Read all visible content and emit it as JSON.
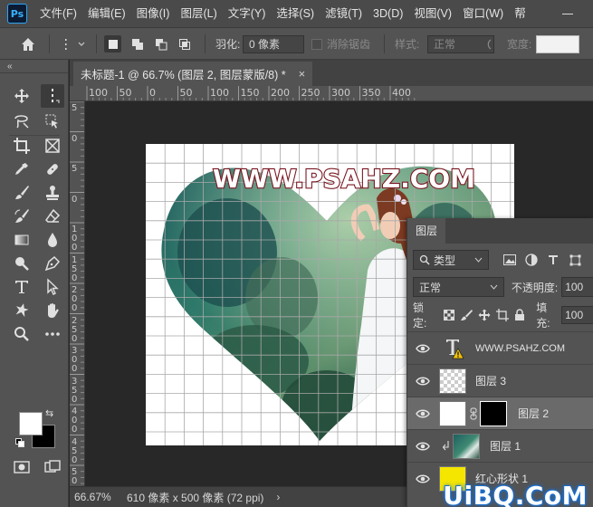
{
  "app": {
    "logo": "Ps"
  },
  "menu": [
    "文件(F)",
    "编辑(E)",
    "图像(I)",
    "图层(L)",
    "文字(Y)",
    "选择(S)",
    "滤镜(T)",
    "3D(D)",
    "视图(V)",
    "窗口(W)",
    "帮"
  ],
  "options": {
    "feather_label": "羽化:",
    "feather_value": "0 像素",
    "antialias_label": "消除锯齿",
    "style_label": "样式:",
    "style_value": "正常",
    "width_label": "宽度:"
  },
  "document": {
    "tab_title": "未标题-1 @ 66.7% (图层 2, 图层蒙版/8) *",
    "close_glyph": "×"
  },
  "ruler": {
    "h_labels": [
      "100",
      "50",
      "0",
      "50",
      "100",
      "150",
      "200",
      "250",
      "300",
      "350",
      "400"
    ],
    "v_labels": [
      "5",
      "0",
      "5",
      "0",
      "1\n0\n0",
      "1\n5\n0",
      "2\n0\n0",
      "2\n5\n0",
      "3\n0\n0",
      "3\n5\n0",
      "4\n0\n0",
      "4\n5\n0",
      "5\n0\n0"
    ]
  },
  "canvas": {
    "text": "WWW.PSAHZ.COM",
    "text_color": "#ffffff",
    "stroke_color": "#7a1620"
  },
  "status": {
    "zoom": "66.67%",
    "info": "610 像素 x 500 像素 (72 ppi)",
    "arrow": "›"
  },
  "layers": {
    "tab": "图层",
    "filter_type": "类型",
    "blend_mode": "正常",
    "opacity_label": "不透明度:",
    "opacity_value": "100",
    "lock_label": "锁定:",
    "fill_label": "填充:",
    "fill_value": "100",
    "items": [
      {
        "name": "WWW.PSAHZ.COM",
        "kind": "text"
      },
      {
        "name": "图层 3",
        "kind": "empty"
      },
      {
        "name": "图层 2",
        "kind": "mask",
        "selected": true
      },
      {
        "name": "图层 1",
        "kind": "photo",
        "clipped": true
      },
      {
        "name": "红心形状 1",
        "kind": "shape"
      }
    ]
  },
  "watermark": "UiBQ.CoM",
  "colors": {
    "accent": "#2ea3f2",
    "panel": "#535353",
    "canvas_bg": "#282828",
    "foreground_swatch": "#ffffff",
    "background_swatch": "#000000"
  }
}
